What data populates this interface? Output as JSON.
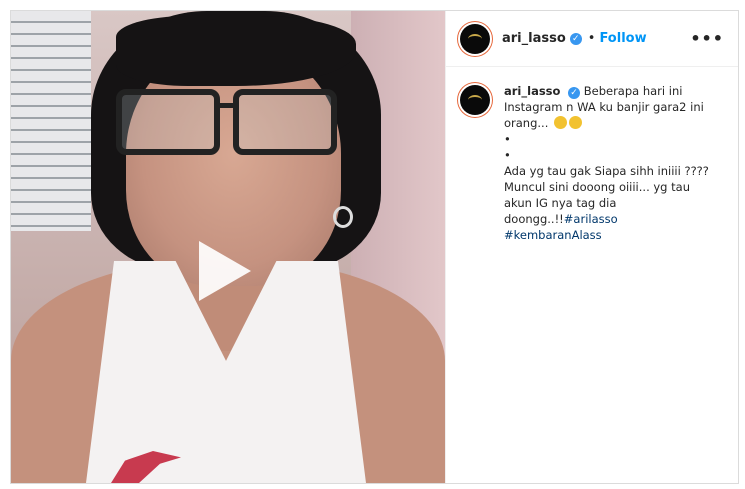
{
  "post": {
    "username": "ari_lasso",
    "follow_label": "Follow",
    "separator": "•",
    "more_label": "•••",
    "verified_glyph": "✓"
  },
  "caption": {
    "username": "ari_lasso",
    "line1": "Beberapa hari ini Instagram n WA ku banjir gara2 ini orang...",
    "bullet1": "•",
    "bullet2": "•",
    "line2": "Ada yg tau gak Siapa sihh iniiii ???? Muncul sini dooong oiiii... yg tau akun IG nya tag dia doongg..!!",
    "hashtag1": "#arilasso",
    "hashtag2": "#kembaranAlass"
  },
  "colors": {
    "follow": "#0095f6",
    "verified": "#3897f0",
    "hashtag": "#00376b"
  },
  "icons": {
    "play": "play-icon",
    "verified": "verified-badge-icon",
    "more": "more-options-icon"
  }
}
